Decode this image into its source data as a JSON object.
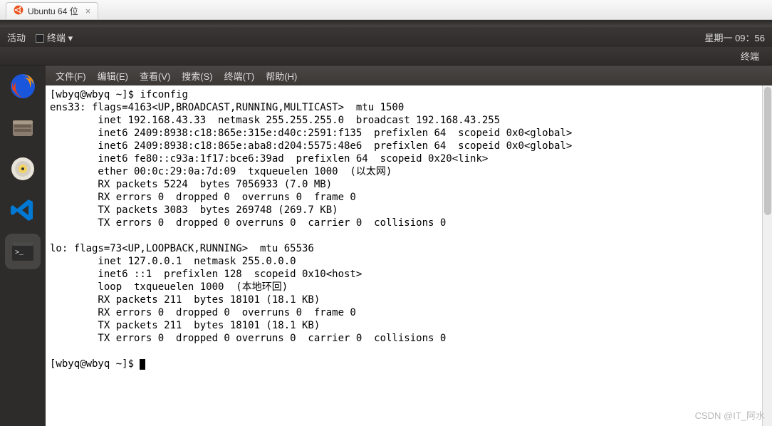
{
  "vm_tab": {
    "label": "Ubuntu 64 位",
    "close": "×"
  },
  "topbar": {
    "activities": "活动",
    "terminal": "终端",
    "datetime": "星期一 09：56"
  },
  "app_title": "终端",
  "menu": {
    "file": "文件(F)",
    "edit": "编辑(E)",
    "view": "查看(V)",
    "search": "搜索(S)",
    "terminal": "终端(T)",
    "help": "帮助(H)"
  },
  "terminal": {
    "prompt1": "[wbyq@wbyq ~]$ ",
    "command1": "ifconfig",
    "output": [
      "ens33: flags=4163<UP,BROADCAST,RUNNING,MULTICAST>  mtu 1500",
      "        inet 192.168.43.33  netmask 255.255.255.0  broadcast 192.168.43.255",
      "        inet6 2409:8938:c18:865e:315e:d40c:2591:f135  prefixlen 64  scopeid 0x0<global>",
      "        inet6 2409:8938:c18:865e:aba8:d204:5575:48e6  prefixlen 64  scopeid 0x0<global>",
      "        inet6 fe80::c93a:1f17:bce6:39ad  prefixlen 64  scopeid 0x20<link>",
      "        ether 00:0c:29:0a:7d:09  txqueuelen 1000  (以太网)",
      "        RX packets 5224  bytes 7056933 (7.0 MB)",
      "        RX errors 0  dropped 0  overruns 0  frame 0",
      "        TX packets 3083  bytes 269748 (269.7 KB)",
      "        TX errors 0  dropped 0 overruns 0  carrier 0  collisions 0",
      "",
      "lo: flags=73<UP,LOOPBACK,RUNNING>  mtu 65536",
      "        inet 127.0.0.1  netmask 255.0.0.0",
      "        inet6 ::1  prefixlen 128  scopeid 0x10<host>",
      "        loop  txqueuelen 1000  (本地环回)",
      "        RX packets 211  bytes 18101 (18.1 KB)",
      "        RX errors 0  dropped 0  overruns 0  frame 0",
      "        TX packets 211  bytes 18101 (18.1 KB)",
      "        TX errors 0  dropped 0 overruns 0  carrier 0  collisions 0",
      ""
    ],
    "prompt2": "[wbyq@wbyq ~]$ "
  },
  "watermark": "CSDN @IT_阿水"
}
